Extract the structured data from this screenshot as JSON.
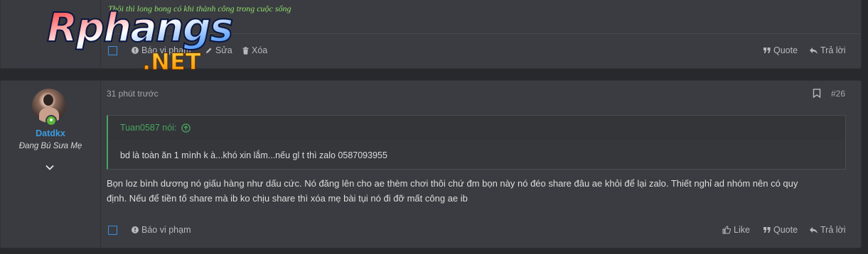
{
  "post1": {
    "signature": "Thôi thì long bong có khi thành công trong cuộc sống",
    "actions": {
      "report": "Báo vi phạm",
      "edit": "Sửa",
      "delete": "Xóa",
      "quote": "Quote",
      "reply": "Trả lời"
    }
  },
  "logo": {
    "brand": "Rphangs",
    "tld": ".NET"
  },
  "post2": {
    "user": {
      "name": "Datdkx",
      "title": "Đang Bú Sưa Mẹ"
    },
    "time": "31 phút trước",
    "post_number": "#26",
    "quote": {
      "author_line": "Tuan0587 nói:",
      "text": "bd là toàn ăn 1 mình k à...khó xin lắm...nếu gl t thì zalo 0587093955"
    },
    "message_line1": "Bọn loz bình dương nó giấu hàng như dấu cức. Nó đăng lên cho ae thèm chơi thôi chứ đm bọn này nó đéo share đâu ae khỏi để lại zalo. Thiết nghỉ ad nhóm nên có quy",
    "message_line2": "định. Nếu để tiền tố share mà ib ko chịu share thì xóa mẹ bài tụi nó đi đỡ mất công ae ib",
    "actions": {
      "report": "Báo vi phạm",
      "like": "Like",
      "quote": "Quote",
      "reply": "Trả lời"
    }
  },
  "colors": {
    "accent": "#3d9ae0",
    "quote_green": "#48a45e",
    "signature_green": "#8fdc6a",
    "online": "#5bb53b"
  }
}
